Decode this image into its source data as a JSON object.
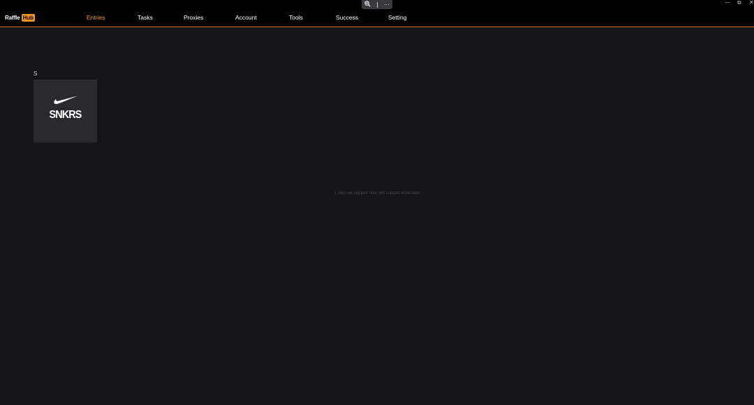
{
  "app": {
    "logo_part1": "Raffle",
    "logo_part2": "Hub"
  },
  "nav": {
    "items": [
      {
        "label": "Entries",
        "active": true
      },
      {
        "label": "Tasks",
        "active": false
      },
      {
        "label": "Proxies",
        "active": false
      },
      {
        "label": "Account",
        "active": false
      },
      {
        "label": "Tools",
        "active": false
      },
      {
        "label": "Success",
        "active": false
      },
      {
        "label": "Setting",
        "active": false
      }
    ]
  },
  "toolbar": {
    "zoom_icon": "zoom-in-icon",
    "more_label": "···"
  },
  "window_controls": {
    "minimize": "—",
    "restore": "⧉",
    "close": "✕"
  },
  "main": {
    "section_letter": "S",
    "sites": [
      {
        "label": "SNKRS",
        "icon": "nike-swoosh-icon"
      }
    ],
    "hint": "1 sites we support now, will support more later"
  },
  "colors": {
    "accent": "#f7971d",
    "background": "#151518",
    "topbar": "#000000",
    "card": "#2a2a2e",
    "divider": "#c8692a"
  }
}
